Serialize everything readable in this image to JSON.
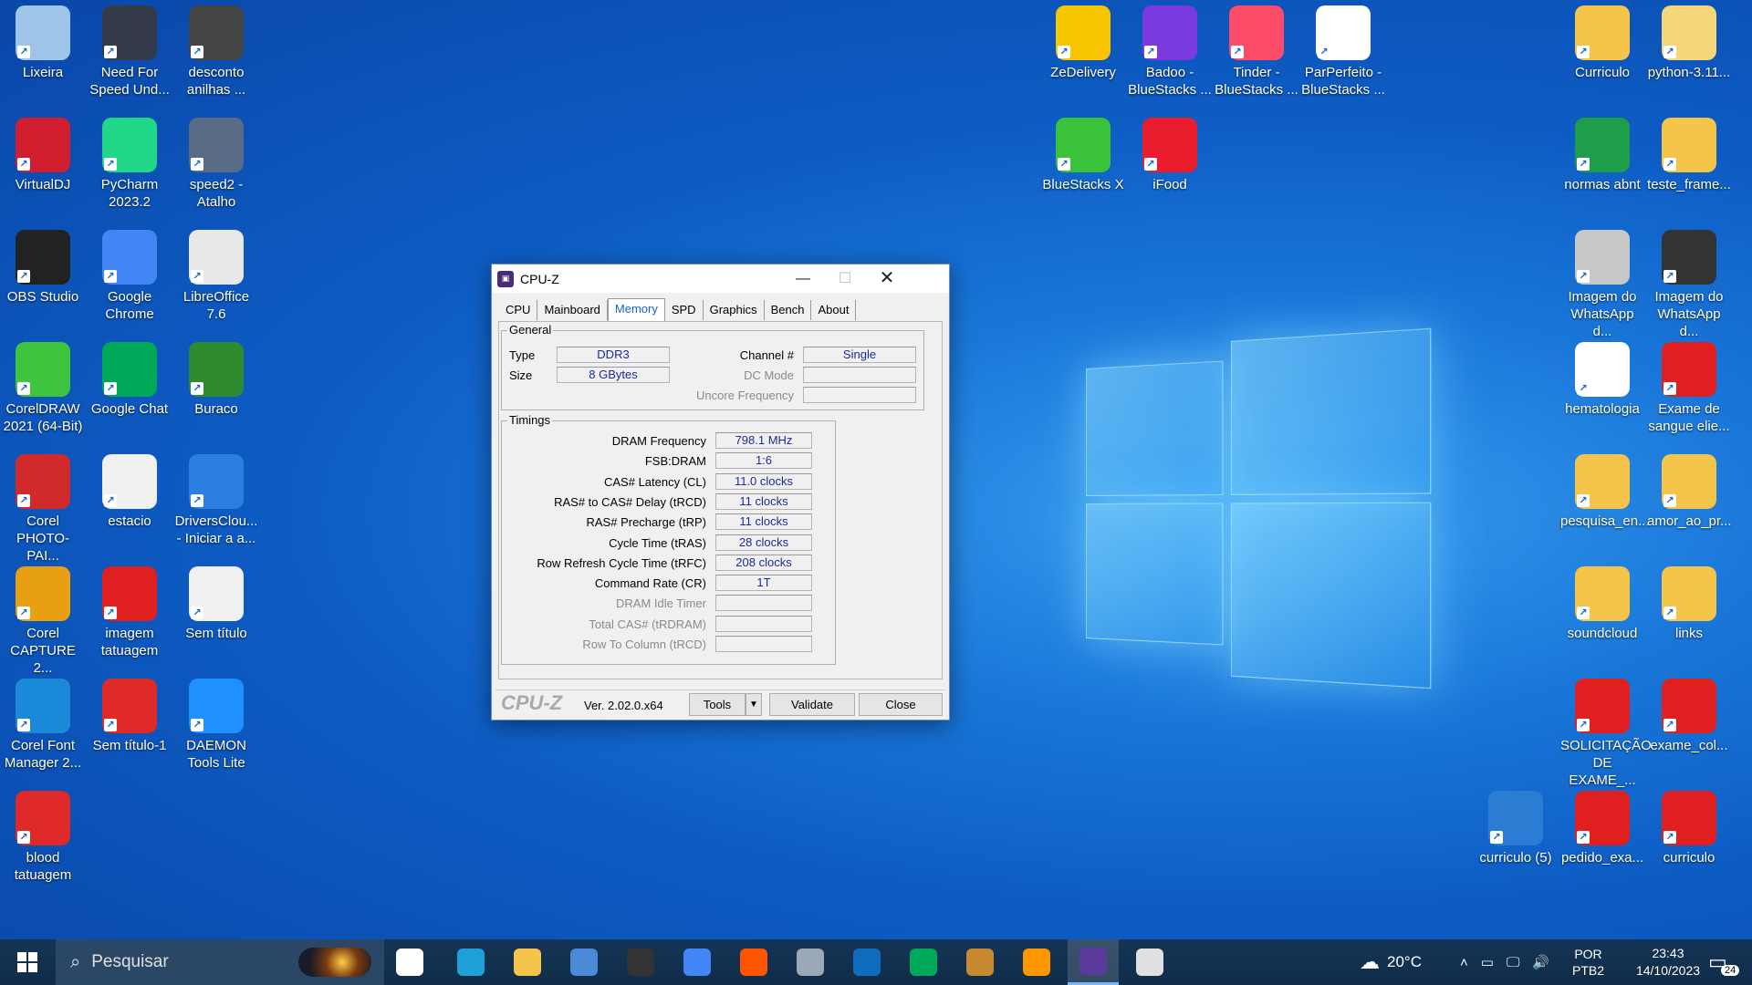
{
  "desktop": {
    "left_icons": [
      {
        "label": "Lixeira",
        "icon": "recycle-bin-icon",
        "color": "#9ec5e8"
      },
      {
        "label": "Need For Speed Und...",
        "icon": "nfs-icon",
        "color": "#333a4a"
      },
      {
        "label": "desconto anilhas ...",
        "icon": "image-file-icon",
        "color": "#444444"
      },
      {
        "label": "VirtualDJ",
        "icon": "virtualdj-icon",
        "color": "#d11f2f"
      },
      {
        "label": "PyCharm 2023.2",
        "icon": "pycharm-icon",
        "color": "#21d789"
      },
      {
        "label": "speed2 - Atalho",
        "icon": "nfs-icon",
        "color": "#5a6b85"
      },
      {
        "label": "OBS Studio",
        "icon": "obs-icon",
        "color": "#222222"
      },
      {
        "label": "Google Chrome",
        "icon": "chrome-icon",
        "color": "#4285f4"
      },
      {
        "label": "LibreOffice 7.6",
        "icon": "file-icon",
        "color": "#e8e8e8"
      },
      {
        "label": "CorelDRAW 2021 (64-Bit)",
        "icon": "coreldraw-icon",
        "color": "#3ec43e"
      },
      {
        "label": "Google Chat",
        "icon": "google-chat-icon",
        "color": "#00a85a"
      },
      {
        "label": "Buraco",
        "icon": "cards-icon",
        "color": "#2e8b2e"
      },
      {
        "label": "Corel PHOTO-PAI...",
        "icon": "corel-photopaint-icon",
        "color": "#d02a2a"
      },
      {
        "label": "estacio",
        "icon": "image-file-icon",
        "color": "#f0f0f0"
      },
      {
        "label": "DriversClou... - Iniciar a a...",
        "icon": "drivers-cloud-icon",
        "color": "#2a7fe0"
      },
      {
        "label": "Corel CAPTURE 2...",
        "icon": "corel-capture-icon",
        "color": "#e8a012"
      },
      {
        "label": "imagem tatuagem",
        "icon": "pdf-icon",
        "color": "#e02020"
      },
      {
        "label": "Sem título",
        "icon": "image-file-icon",
        "color": "#f0f0f0"
      },
      {
        "label": "Corel Font Manager 2...",
        "icon": "corel-font-icon",
        "color": "#1a8ad8"
      },
      {
        "label": "Sem título-1",
        "icon": "blood-icon",
        "color": "#e02a2a"
      },
      {
        "label": "DAEMON Tools Lite",
        "icon": "daemon-tools-icon",
        "color": "#1e90ff"
      },
      {
        "label": "blood tatuagem",
        "icon": "blood-icon",
        "color": "#e02a2a"
      }
    ],
    "mid_icons": [
      {
        "label": "ZeDelivery",
        "icon": "zedelivery-icon",
        "color": "#f7c600"
      },
      {
        "label": "Badoo - BlueStacks ...",
        "icon": "badoo-icon",
        "color": "#7a3ae0"
      },
      {
        "label": "Tinder - BlueStacks ...",
        "icon": "tinder-icon",
        "color": "#fd4b6a"
      },
      {
        "label": "ParPerfeito - BlueStacks ...",
        "icon": "parperfeito-icon",
        "color": "#ffffff"
      },
      {
        "label": "BlueStacks X",
        "icon": "bluestacks-icon",
        "color": "#3ac23a"
      },
      {
        "label": "iFood",
        "icon": "ifood-icon",
        "color": "#ea1d2c"
      }
    ],
    "right_icons": [
      {
        "label": "Curriculo",
        "icon": "folder-icon",
        "color": "#f5c44a"
      },
      {
        "label": "python-3.11...",
        "icon": "folder-icon",
        "color": "#f5d77a"
      },
      {
        "label": "normas abnt",
        "icon": "sheets-icon",
        "color": "#1e9e4a"
      },
      {
        "label": "teste_frame...",
        "icon": "chrome-file-icon",
        "color": "#f5c44a"
      },
      {
        "label": "Imagem do WhatsApp d...",
        "icon": "photo-icon",
        "color": "#c8c8c8"
      },
      {
        "label": "Imagem do WhatsApp d...",
        "icon": "photo-icon",
        "color": "#333333"
      },
      {
        "label": "hematologia",
        "icon": "image-file-icon",
        "color": "#ffffff"
      },
      {
        "label": "Exame de sangue elie...",
        "icon": "pdf-icon",
        "color": "#e02020"
      },
      {
        "label": "pesquisa_en...",
        "icon": "chrome-file-icon",
        "color": "#f5c44a"
      },
      {
        "label": "amor_ao_pr...",
        "icon": "chrome-file-icon",
        "color": "#f5c44a"
      },
      {
        "label": "soundcloud",
        "icon": "chrome-file-icon",
        "color": "#f5c44a"
      },
      {
        "label": "links",
        "icon": "chrome-file-icon",
        "color": "#f5c44a"
      },
      {
        "label": "SOLICITAÇÃO DE EXAME_...",
        "icon": "pdf-icon",
        "color": "#e02020"
      },
      {
        "label": "exame_col...",
        "icon": "pdf-icon",
        "color": "#e02020"
      },
      {
        "label": "curriculo (5)",
        "icon": "document-icon",
        "color": "#2b7cd3"
      },
      {
        "label": "pedido_exa...",
        "icon": "pdf-icon",
        "color": "#e02020"
      },
      {
        "label": "curriculo",
        "icon": "pdf-icon",
        "color": "#e02020"
      }
    ]
  },
  "cpuz": {
    "title": "CPU-Z",
    "tabs": [
      "CPU",
      "Mainboard",
      "Memory",
      "SPD",
      "Graphics",
      "Bench",
      "About"
    ],
    "active_tab": "Memory",
    "general": {
      "label": "General",
      "type_label": "Type",
      "type_value": "DDR3",
      "size_label": "Size",
      "size_value": "8 GBytes",
      "channel_label": "Channel #",
      "channel_value": "Single",
      "dc_mode_label": "DC Mode",
      "dc_mode_value": "",
      "uncore_label": "Uncore Frequency",
      "uncore_value": ""
    },
    "timings": {
      "label": "Timings",
      "rows": [
        {
          "label": "DRAM Frequency",
          "value": "798.1 MHz",
          "enabled": true
        },
        {
          "label": "FSB:DRAM",
          "value": "1:6",
          "enabled": true
        },
        {
          "label": "CAS# Latency (CL)",
          "value": "11.0 clocks",
          "enabled": true
        },
        {
          "label": "RAS# to CAS# Delay (tRCD)",
          "value": "11 clocks",
          "enabled": true
        },
        {
          "label": "RAS# Precharge (tRP)",
          "value": "11 clocks",
          "enabled": true
        },
        {
          "label": "Cycle Time (tRAS)",
          "value": "28 clocks",
          "enabled": true
        },
        {
          "label": "Row Refresh Cycle Time (tRFC)",
          "value": "208 clocks",
          "enabled": true
        },
        {
          "label": "Command Rate (CR)",
          "value": "1T",
          "enabled": true
        },
        {
          "label": "DRAM Idle Timer",
          "value": "",
          "enabled": false
        },
        {
          "label": "Total CAS# (tRDRAM)",
          "value": "",
          "enabled": false
        },
        {
          "label": "Row To Column (tRCD)",
          "value": "",
          "enabled": false
        }
      ]
    },
    "footer": {
      "logo": "CPU-Z",
      "version": "Ver. 2.02.0.x64",
      "tools_label": "Tools",
      "validate_label": "Validate",
      "close_label": "Close"
    }
  },
  "taskbar": {
    "search_placeholder": "Pesquisar",
    "weather": "20°C",
    "language_line1": "POR",
    "language_line2": "PTB2",
    "time": "23:43",
    "date": "14/10/2023",
    "notification_count": "24",
    "apps": [
      {
        "name": "task-view-icon",
        "color": "#ffffff"
      },
      {
        "name": "edge-icon",
        "color": "#1fa1d8"
      },
      {
        "name": "file-explorer-icon",
        "color": "#f5c44a"
      },
      {
        "name": "microsoft-store-icon",
        "color": "#4a8ad8"
      },
      {
        "name": "audio-app-icon",
        "color": "#333333"
      },
      {
        "name": "chrome-icon",
        "color": "#4285f4"
      },
      {
        "name": "soundcloud-icon",
        "color": "#ff5500"
      },
      {
        "name": "camera-icon",
        "color": "#9aa8b8"
      },
      {
        "name": "outlook-icon",
        "color": "#0f6cbd"
      },
      {
        "name": "google-chat-icon",
        "color": "#00a85a"
      },
      {
        "name": "game-icon",
        "color": "#c88a30"
      },
      {
        "name": "sublime-icon",
        "color": "#ff9800"
      },
      {
        "name": "cpuz-icon",
        "color": "#5a3a9a"
      },
      {
        "name": "paint-icon",
        "color": "#e0e0e0"
      }
    ]
  }
}
